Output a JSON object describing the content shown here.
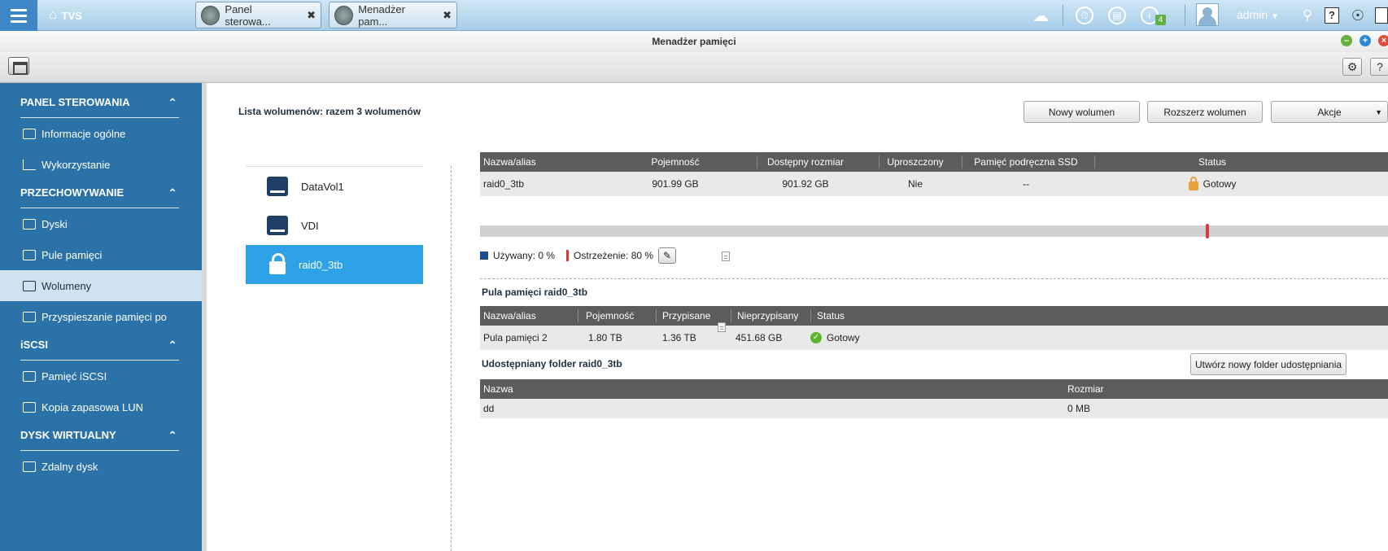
{
  "taskbar": {
    "home_label": "TVS",
    "tabs": [
      {
        "label": "Panel sterowa..."
      },
      {
        "label": "Menadżer pam..."
      }
    ],
    "notification_count": "4",
    "user": "admin"
  },
  "window": {
    "title": "Menadżer pamięci"
  },
  "sidebar": {
    "sections": [
      {
        "label": "PANEL STEROWANIA",
        "items": [
          "Informacje ogólne",
          "Wykorzystanie"
        ]
      },
      {
        "label": "PRZECHOWYWANIE",
        "items": [
          "Dyski",
          "Pule pamięci",
          "Wolumeny",
          "Przyspieszanie pamięci po"
        ]
      },
      {
        "label": "iSCSI",
        "items": [
          "Pamięć iSCSI",
          "Kopia zapasowa LUN"
        ]
      },
      {
        "label": "DYSK WIRTUALNY",
        "items": [
          "Zdalny dysk"
        ]
      }
    ],
    "active_item": "Wolumeny"
  },
  "main": {
    "list_title": "Lista wolumenów: razem 3 wolumenów",
    "buttons": {
      "new_volume": "Nowy wolumen",
      "expand_volume": "Rozszerz wolumen",
      "actions": "Akcje"
    },
    "volumes": [
      {
        "name": "DataVol1",
        "icon": "disk-icon"
      },
      {
        "name": "VDI",
        "icon": "disk-icon"
      },
      {
        "name": "raid0_3tb",
        "icon": "lock-icon",
        "selected": true
      }
    ],
    "volume_table": {
      "headers": [
        "Nazwa/alias",
        "Pojemność",
        "Dostępny rozmiar",
        "Uproszczony",
        "Pamięć podręczna SSD",
        "Status"
      ],
      "row": {
        "name": "raid0_3tb",
        "capacity": "901.99 GB",
        "available": "901.92 GB",
        "thin": "Nie",
        "ssd_cache": "--",
        "status": "Gotowy"
      }
    },
    "usage": {
      "used_label": "Używany: 0 %",
      "warning_label": "Ostrzeżenie: 80 %",
      "used_percent": 0,
      "warning_percent": 80,
      "used_color": "#1e4c92",
      "warning_color": "#d43b3b"
    },
    "pool": {
      "title": "Pula pamięci raid0_3tb",
      "headers": [
        "Nazwa/alias",
        "Pojemność",
        "Przypisane",
        "Nieprzypisany",
        "Status"
      ],
      "row": {
        "name": "Pula pamięci 2",
        "capacity": "1.80 TB",
        "assigned": "1.36 TB",
        "unassigned": "451.68 GB",
        "status": "Gotowy"
      }
    },
    "shared": {
      "title": "Udostępniany folder raid0_3tb",
      "create_button": "Utwórz nowy folder udostępniania",
      "headers": [
        "Nazwa",
        "Rozmiar"
      ],
      "row": {
        "name": "dd",
        "size": "0 MB"
      }
    }
  }
}
